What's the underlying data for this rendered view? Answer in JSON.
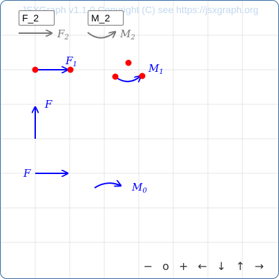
{
  "board": {
    "copyright": "JSXGraph v1.1.0 Copyright (C) see https://jsxgraph.org"
  },
  "inputs": {
    "f2_value": "F_2",
    "m2_value": "M_2"
  },
  "labels": {
    "f2_base": "F",
    "f2_sub": "2",
    "m2_base": "M",
    "m2_sub": "2",
    "f1_base": "F",
    "f1_sub": "1",
    "m1_base": "M",
    "m1_sub": "1",
    "f_vertical": "F",
    "f_horizontal": "F",
    "m0_base": "M",
    "m0_sub": "0"
  },
  "navigation": {
    "zoom_out": "−",
    "zoom_reset": "o",
    "zoom_in": "+",
    "left": "←",
    "down": "↓",
    "up": "↑",
    "right": "→"
  },
  "colors": {
    "primary": "#0000ff",
    "secondary": "#777777",
    "point": "#ff0000",
    "grid": "#e4e4e4",
    "border": "#356aa0"
  }
}
